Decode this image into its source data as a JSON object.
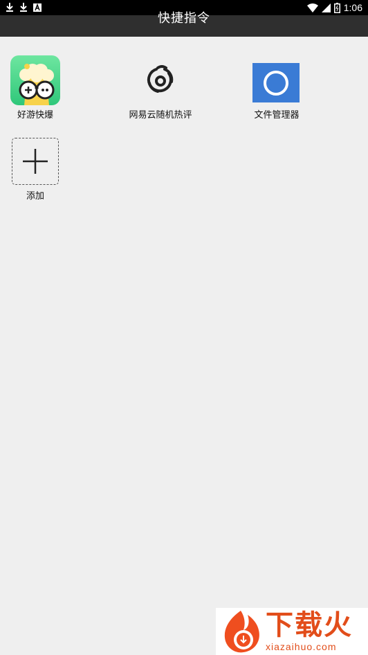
{
  "status_bar": {
    "time": "1:06",
    "left_icons": [
      "download-icon",
      "download-icon",
      "a-badge-icon"
    ],
    "right_icons": [
      "wifi-icon",
      "signal-icon",
      "battery-icon"
    ]
  },
  "app_bar": {
    "title": "快捷指令"
  },
  "shortcuts": [
    {
      "label": "好游快爆",
      "icon": "haoyou-kuaibao-app-icon"
    },
    {
      "label": "网易云随机热评",
      "icon": "netease-cloud-music-icon"
    },
    {
      "label": "文件管理器",
      "icon": "file-manager-circle-icon"
    }
  ],
  "add": {
    "label": "添加",
    "icon": "plus-icon"
  },
  "watermark": {
    "text": "下载火",
    "url": "xiazaihuo.com"
  },
  "colors": {
    "background": "#efefef",
    "app_bar": "#2f2f2f",
    "status_bar": "#000000",
    "file_manager_blue": "#3a7bd5",
    "haoyou_green": "#43d48a",
    "watermark_orange": "#e24d1a"
  }
}
